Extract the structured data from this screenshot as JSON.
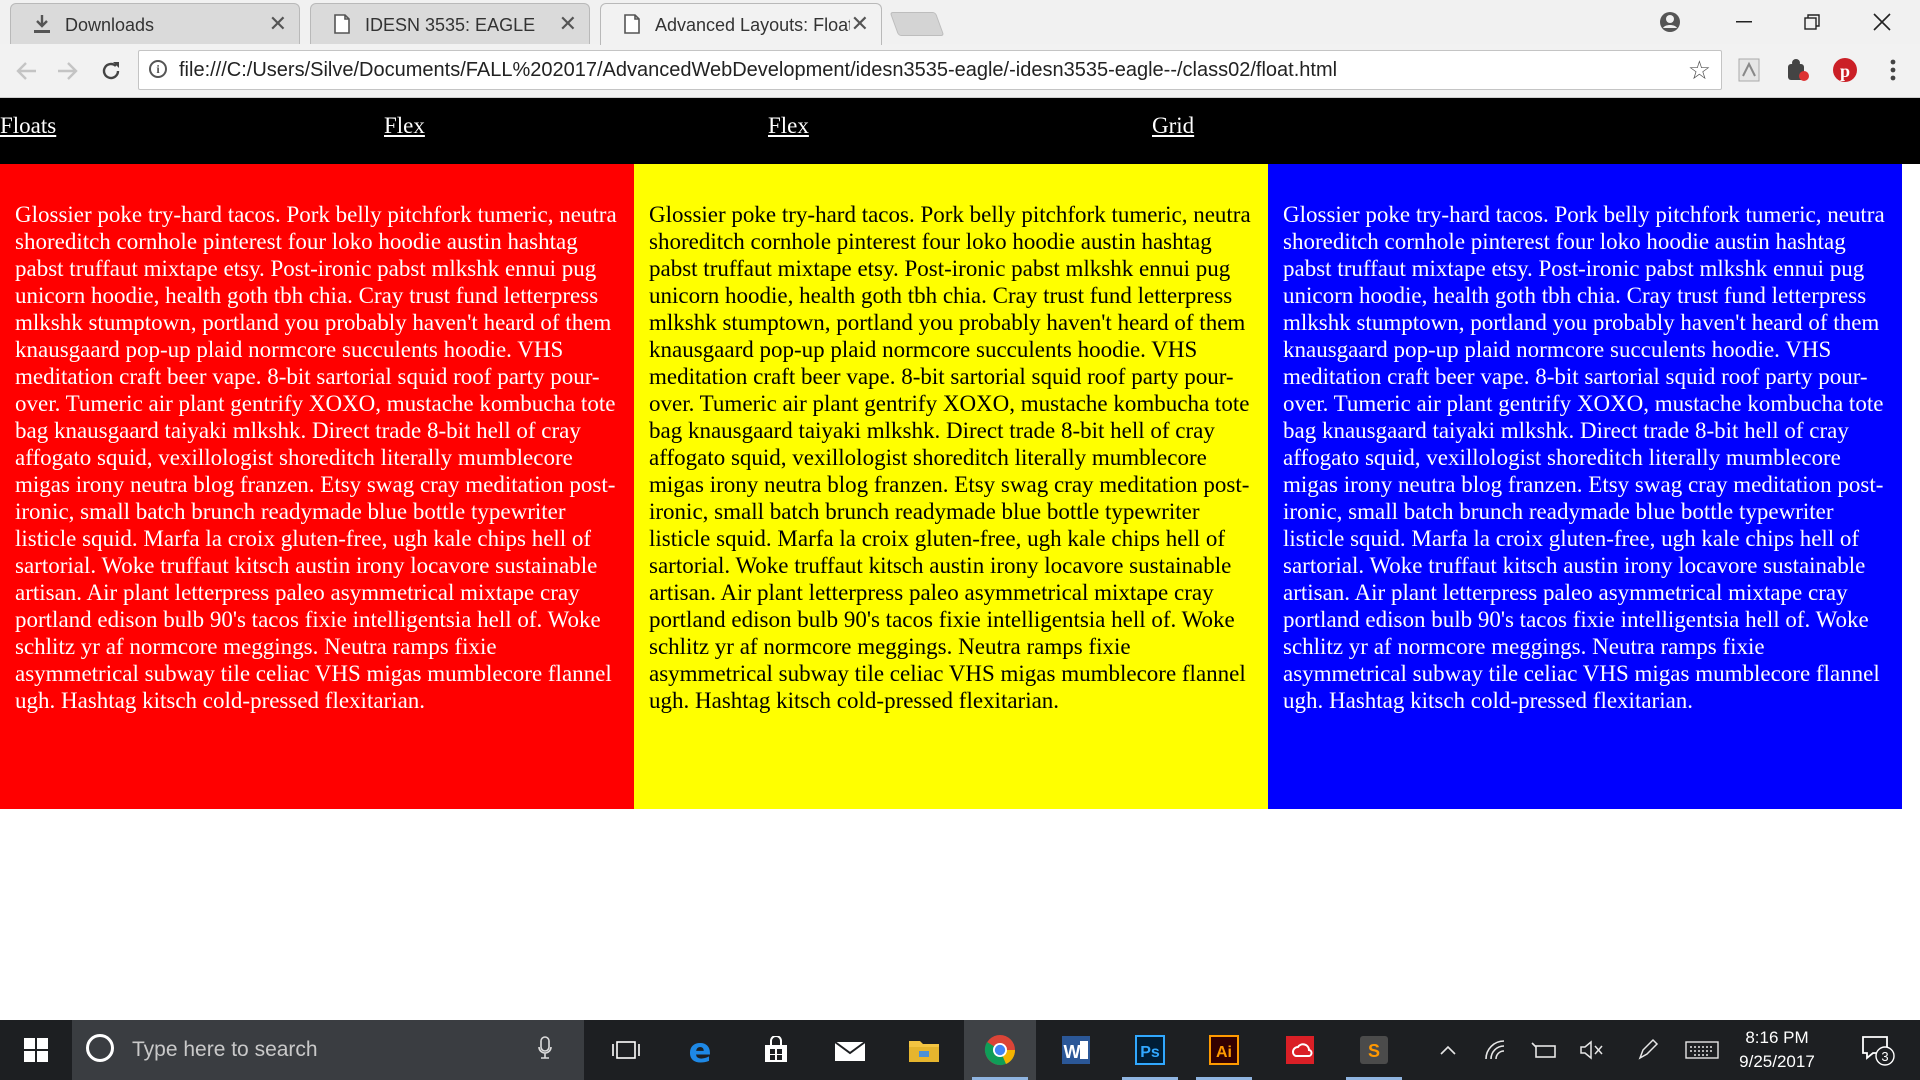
{
  "browser": {
    "tabs": [
      {
        "label": "Downloads",
        "icon": "download-icon",
        "active": false
      },
      {
        "label": "IDESN 3535: EAGLE",
        "icon": "document-icon",
        "active": false
      },
      {
        "label": "Advanced Layouts: Floats",
        "icon": "document-icon",
        "active": true
      }
    ],
    "url": "file:///C:/Users/Silve/Documents/FALL%202017/AdvancedWebDevelopment/idesn3535-eagle/-idesn3535-eagle--/class02/float.html"
  },
  "page": {
    "nav": [
      "Floats",
      "Flex",
      "Flex",
      "Grid"
    ],
    "columns": [
      {
        "color": "#ff0000",
        "text": "Glossier poke try-hard tacos. Pork belly pitchfork tumeric, neutra shoreditch cornhole pinterest four loko hoodie austin hashtag pabst truffaut mixtape etsy. Post-ironic pabst mlkshk ennui pug unicorn hoodie, health goth tbh chia. Cray trust fund letterpress mlkshk stumptown, portland you probably haven't heard of them knausgaard pop-up plaid normcore succulents hoodie. VHS meditation craft beer vape. 8-bit sartorial squid roof party pour-over. Tumeric air plant gentrify XOXO, mustache kombucha tote bag knausgaard taiyaki mlkshk. Direct trade 8-bit hell of cray affogato squid, vexillologist shoreditch literally mumblecore migas irony neutra blog franzen. Etsy swag cray meditation post-ironic, small batch brunch readymade blue bottle typewriter listicle squid. Marfa la croix gluten-free, ugh kale chips hell of sartorial. Woke truffaut kitsch austin irony locavore sustainable artisan. Air plant letterpress paleo asymmetrical mixtape cray portland edison bulb 90's tacos fixie intelligentsia hell of. Woke schlitz yr af normcore meggings. Neutra ramps fixie asymmetrical subway tile celiac VHS migas mumblecore flannel ugh. Hashtag kitsch cold-pressed flexitarian."
      },
      {
        "color": "#ffff00",
        "text": "Glossier poke try-hard tacos. Pork belly pitchfork tumeric, neutra shoreditch cornhole pinterest four loko hoodie austin hashtag pabst truffaut mixtape etsy. Post-ironic pabst mlkshk ennui pug unicorn hoodie, health goth tbh chia. Cray trust fund letterpress mlkshk stumptown, portland you probably haven't heard of them knausgaard pop-up plaid normcore succulents hoodie. VHS meditation craft beer vape. 8-bit sartorial squid roof party pour-over. Tumeric air plant gentrify XOXO, mustache kombucha tote bag knausgaard taiyaki mlkshk. Direct trade 8-bit hell of cray affogato squid, vexillologist shoreditch literally mumblecore migas irony neutra blog franzen. Etsy swag cray meditation post-ironic, small batch brunch readymade blue bottle typewriter listicle squid. Marfa la croix gluten-free, ugh kale chips hell of sartorial. Woke truffaut kitsch austin irony locavore sustainable artisan. Air plant letterpress paleo asymmetrical mixtape cray portland edison bulb 90's tacos fixie intelligentsia hell of. Woke schlitz yr af normcore meggings. Neutra ramps fixie asymmetrical subway tile celiac VHS migas mumblecore flannel ugh. Hashtag kitsch cold-pressed flexitarian."
      },
      {
        "color": "#0000ff",
        "text": "Glossier poke try-hard tacos. Pork belly pitchfork tumeric, neutra shoreditch cornhole pinterest four loko hoodie austin hashtag pabst truffaut mixtape etsy. Post-ironic pabst mlkshk ennui pug unicorn hoodie, health goth tbh chia. Cray trust fund letterpress mlkshk stumptown, portland you probably haven't heard of them knausgaard pop-up plaid normcore succulents hoodie. VHS meditation craft beer vape. 8-bit sartorial squid roof party pour-over. Tumeric air plant gentrify XOXO, mustache kombucha tote bag knausgaard taiyaki mlkshk. Direct trade 8-bit hell of cray affogato squid, vexillologist shoreditch literally mumblecore migas irony neutra blog franzen. Etsy swag cray meditation post-ironic, small batch brunch readymade blue bottle typewriter listicle squid. Marfa la croix gluten-free, ugh kale chips hell of sartorial. Woke truffaut kitsch austin irony locavore sustainable artisan. Air plant letterpress paleo asymmetrical mixtape cray portland edison bulb 90's tacos fixie intelligentsia hell of. Woke schlitz yr af normcore meggings. Neutra ramps fixie asymmetrical subway tile celiac VHS migas mumblecore flannel ugh. Hashtag kitsch cold-pressed flexitarian."
      }
    ]
  },
  "taskbar": {
    "search_placeholder": "Type here to search",
    "time": "8:16 PM",
    "date": "9/25/2017",
    "notification_count": "3",
    "pinned": [
      "task-view-icon",
      "edge-icon",
      "store-icon",
      "mail-icon",
      "file-explorer-icon",
      "chrome-icon",
      "word-icon",
      "photoshop-icon",
      "illustrator-icon",
      "creative-cloud-icon",
      "sublime-text-icon"
    ],
    "photoshop_label": "Ps",
    "illustrator_label": "Ai",
    "word_label": "W",
    "sublime_label": "S"
  }
}
